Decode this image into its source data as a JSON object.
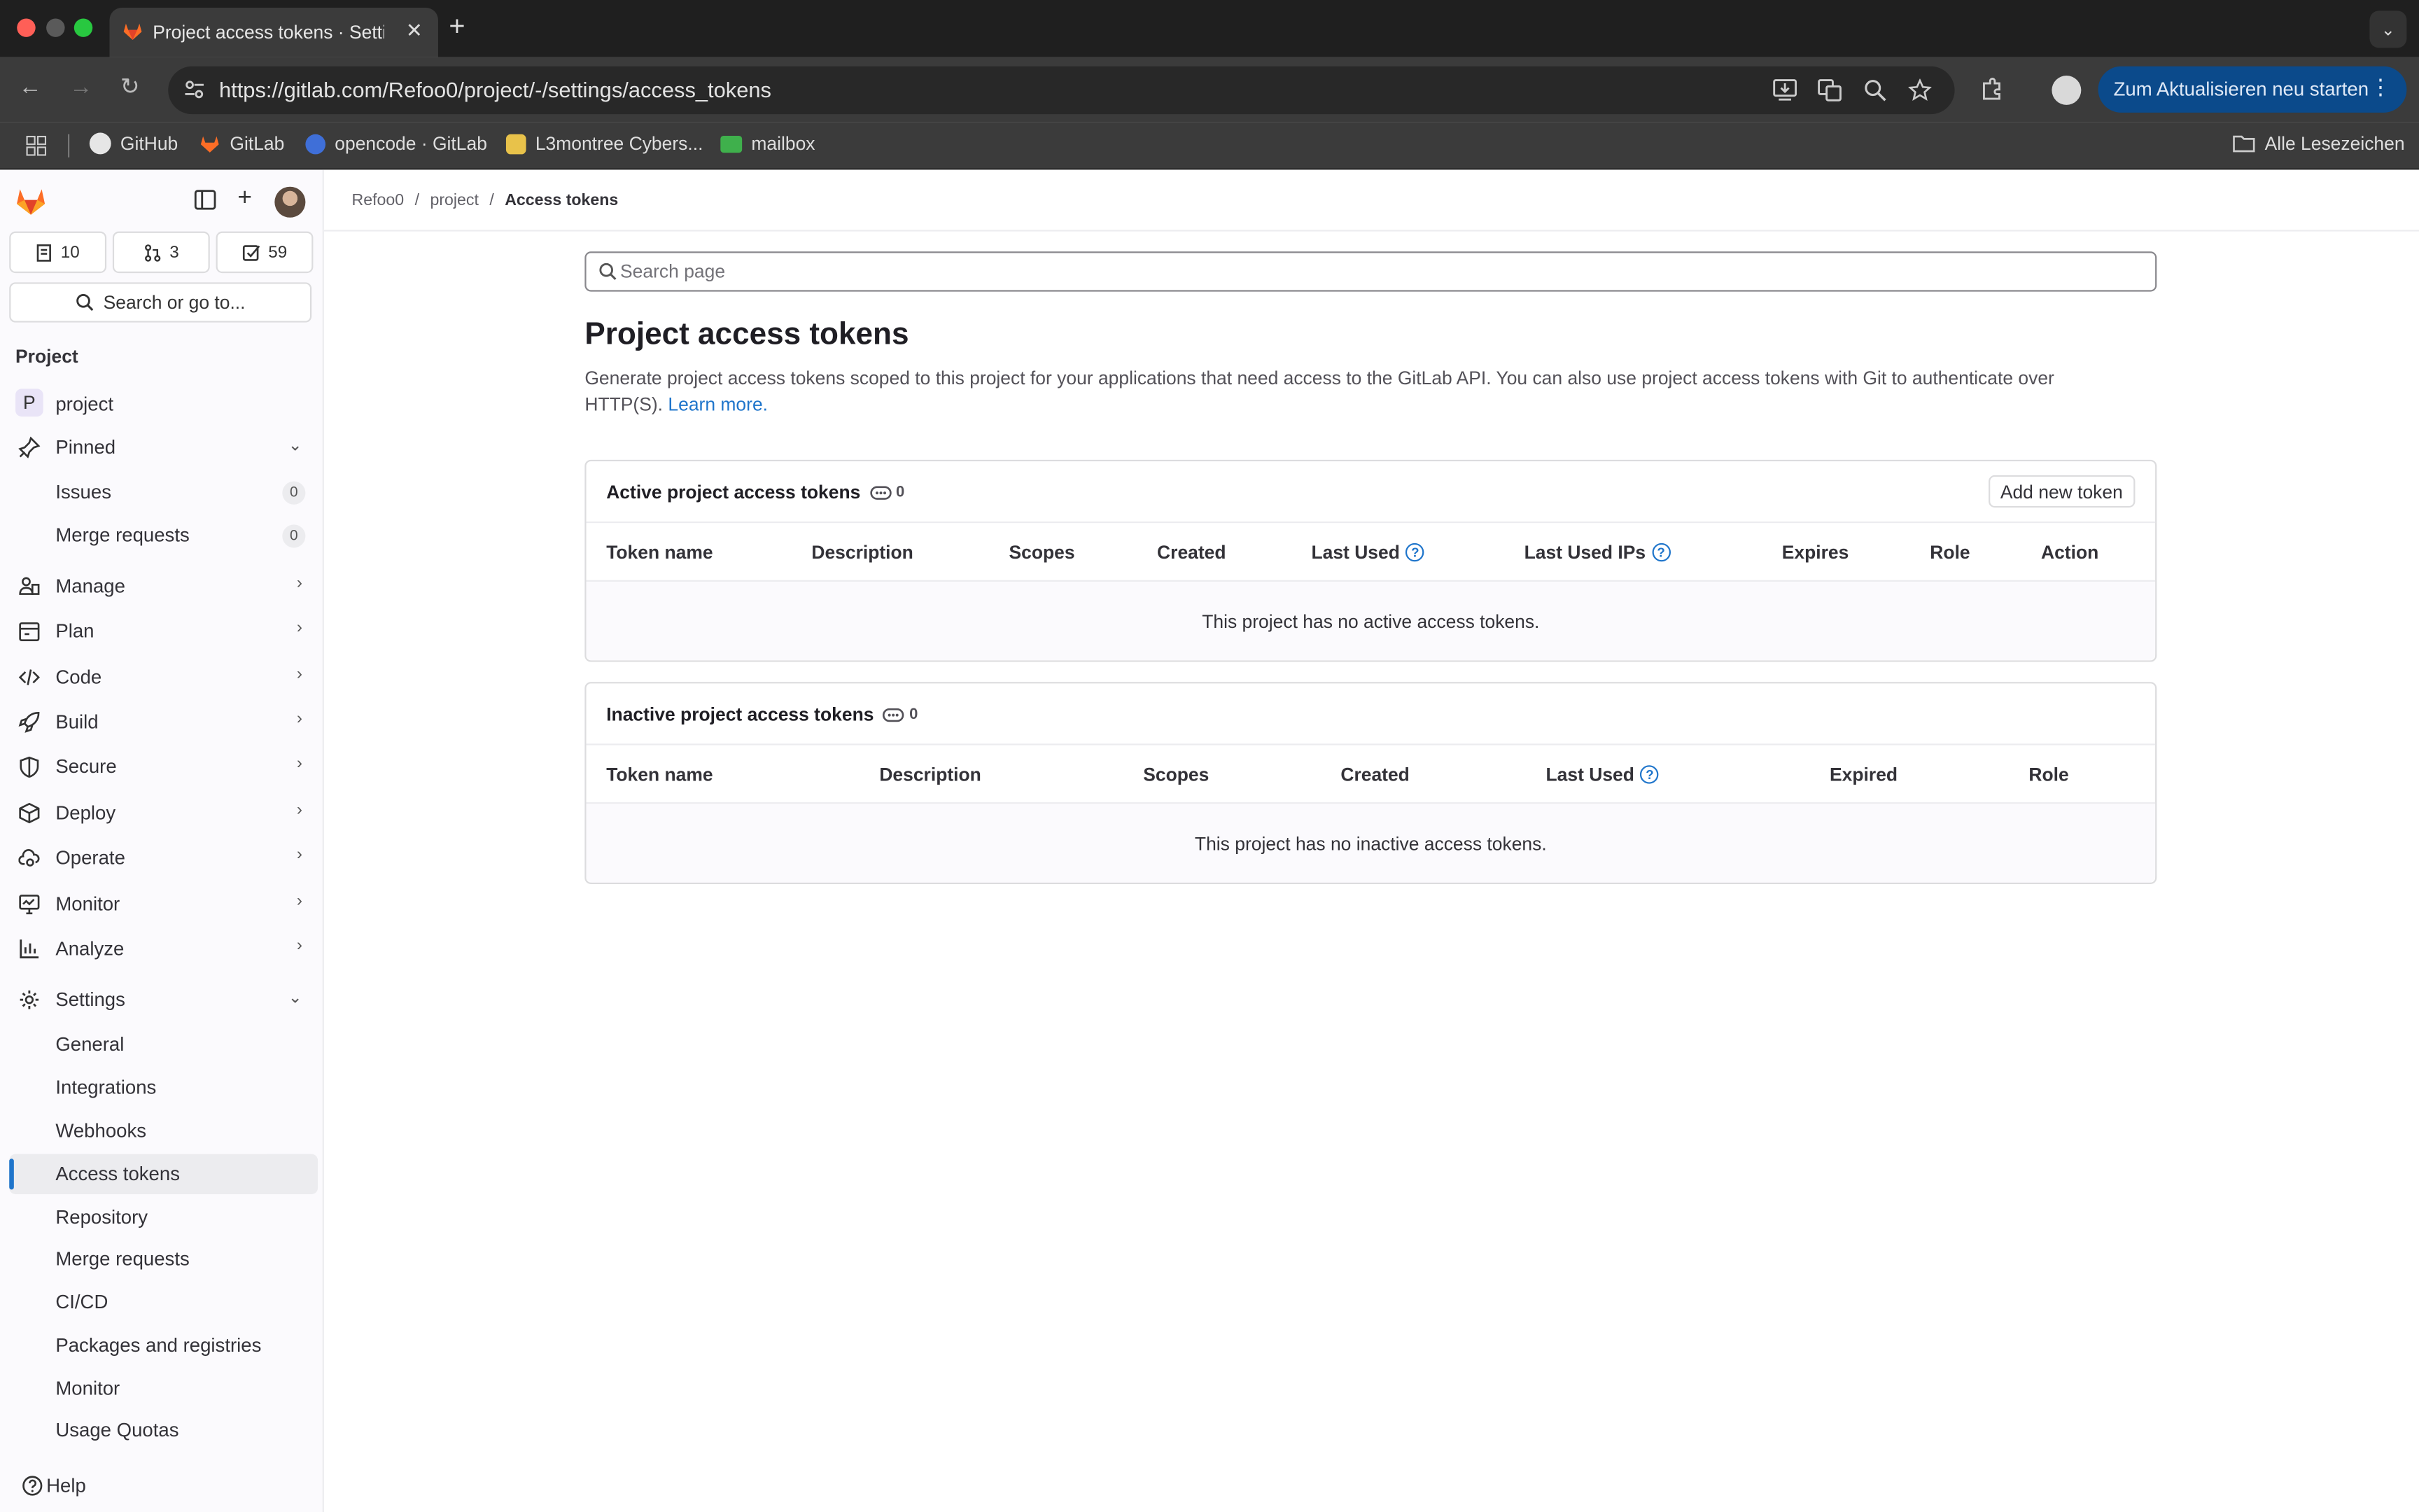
{
  "browser": {
    "tab_title": "Project access tokens · Settings",
    "url": "https://gitlab.com/Refoo0/project/-/settings/access_tokens",
    "update_button": "Zum Aktualisieren neu starten",
    "bookmarks": [
      {
        "label": "GitHub"
      },
      {
        "label": "GitLab"
      },
      {
        "label": "opencode · GitLab"
      },
      {
        "label": "L3montree Cybers..."
      },
      {
        "label": "mailbox"
      }
    ],
    "all_bookmarks": "Alle Lesezeichen"
  },
  "sidebar": {
    "counts": {
      "issues": "10",
      "merge_requests": "3",
      "todos": "59"
    },
    "search": "Search or go to...",
    "heading": "Project",
    "project_name": "project",
    "project_initial": "P",
    "pinned": "Pinned",
    "pinned_items": [
      {
        "label": "Issues",
        "badge": "0"
      },
      {
        "label": "Merge requests",
        "badge": "0"
      }
    ],
    "sections": [
      {
        "label": "Manage"
      },
      {
        "label": "Plan"
      },
      {
        "label": "Code"
      },
      {
        "label": "Build"
      },
      {
        "label": "Secure"
      },
      {
        "label": "Deploy"
      },
      {
        "label": "Operate"
      },
      {
        "label": "Monitor"
      },
      {
        "label": "Analyze"
      }
    ],
    "settings": "Settings",
    "settings_items": [
      {
        "label": "General"
      },
      {
        "label": "Integrations"
      },
      {
        "label": "Webhooks"
      },
      {
        "label": "Access tokens"
      },
      {
        "label": "Repository"
      },
      {
        "label": "Merge requests"
      },
      {
        "label": "CI/CD"
      },
      {
        "label": "Packages and registries"
      },
      {
        "label": "Monitor"
      },
      {
        "label": "Usage Quotas"
      }
    ],
    "help": "Help"
  },
  "breadcrumb": [
    "Refoo0",
    "project",
    "Access tokens"
  ],
  "main": {
    "search_placeholder": "Search page",
    "title": "Project access tokens",
    "description": "Generate project access tokens scoped to this project for your applications that need access to the GitLab API. You can also use project access tokens with Git to authenticate over HTTP(S).",
    "learn_more": "Learn more.",
    "active": {
      "title": "Active project access tokens",
      "count": "0",
      "add_button": "Add new token",
      "columns": [
        "Token name",
        "Description",
        "Scopes",
        "Created",
        "Last Used",
        "Last Used IPs",
        "Expires",
        "Role",
        "Action"
      ],
      "empty": "This project has no active access tokens."
    },
    "inactive": {
      "title": "Inactive project access tokens",
      "count": "0",
      "columns": [
        "Token name",
        "Description",
        "Scopes",
        "Created",
        "Last Used",
        "Expired",
        "Role"
      ],
      "empty": "This project has no inactive access tokens."
    }
  },
  "colors": {
    "accent": "#1f75cb",
    "update_button": "#0b4a8b",
    "gitlab_orange": "#fc6d26"
  }
}
